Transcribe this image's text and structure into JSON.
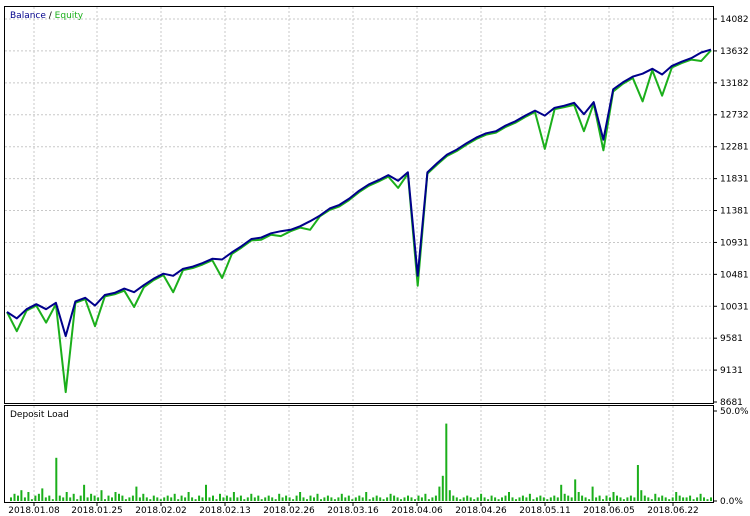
{
  "legend": {
    "balance_label": "Balance",
    "separator": " / ",
    "equity_label": "Equity"
  },
  "deposit_panel": {
    "title": "Deposit Load"
  },
  "colors": {
    "balance": "#00008B",
    "equity": "#1BAF1B",
    "deposit_bar": "#1BAF1B",
    "grid": "#C8C8C8",
    "frame": "#000000"
  },
  "chart_data": [
    {
      "type": "line",
      "title": "",
      "legend": [
        "Balance",
        "Equity"
      ],
      "legend_position": "top-left",
      "grid": true,
      "y_ticks": [
        "14082",
        "13632",
        "13182",
        "12732",
        "12281",
        "11831",
        "11381",
        "10931",
        "10481",
        "10031",
        "9581",
        "9131",
        "8681"
      ],
      "ylim": [
        8681,
        14082
      ],
      "x_ticks": [
        "2018.01.08",
        "2018.01.25",
        "2018.02.02",
        "2018.02.13",
        "2018.02.26",
        "2018.03.16",
        "2018.04.06",
        "2018.04.26",
        "2018.05.11",
        "2018.06.05",
        "2018.06.22"
      ],
      "series": [
        {
          "name": "Balance",
          "values": [
            9950,
            9860,
            9990,
            10060,
            9990,
            10080,
            9610,
            10100,
            10150,
            10040,
            10190,
            10220,
            10280,
            10230,
            10330,
            10420,
            10490,
            10460,
            10560,
            10590,
            10640,
            10700,
            10690,
            10790,
            10880,
            10980,
            11000,
            11060,
            11090,
            11110,
            11160,
            11230,
            11310,
            11410,
            11460,
            11550,
            11660,
            11750,
            11810,
            11880,
            11800,
            11920,
            10460,
            11920,
            12050,
            12170,
            12240,
            12330,
            12410,
            12470,
            12500,
            12580,
            12640,
            12720,
            12790,
            12720,
            12830,
            12860,
            12900,
            12740,
            12910,
            12380,
            13090,
            13190,
            13270,
            13310,
            13380,
            13300,
            13420,
            13480,
            13530,
            13610,
            13650
          ]
        },
        {
          "name": "Equity",
          "values": [
            9950,
            9680,
            9970,
            10040,
            9800,
            10060,
            8820,
            10080,
            10130,
            9750,
            10170,
            10200,
            10250,
            10020,
            10300,
            10400,
            10470,
            10230,
            10540,
            10570,
            10620,
            10680,
            10430,
            10770,
            10860,
            10960,
            10970,
            11040,
            11020,
            11090,
            11140,
            11110,
            11300,
            11390,
            11440,
            11530,
            11640,
            11730,
            11790,
            11860,
            11700,
            11900,
            10320,
            11900,
            12030,
            12150,
            12220,
            12310,
            12390,
            12450,
            12480,
            12560,
            12620,
            12700,
            12770,
            12250,
            12810,
            12840,
            12870,
            12500,
            12890,
            12230,
            13060,
            13170,
            13250,
            12920,
            13360,
            13000,
            13400,
            13460,
            13510,
            13490,
            13640
          ]
        }
      ]
    },
    {
      "type": "bar",
      "title": "Deposit Load",
      "y_ticks": [
        "50.0%",
        "0.0%"
      ],
      "ylim": [
        0,
        50
      ],
      "unit": "%",
      "values": [
        2,
        4,
        3,
        6,
        2,
        5,
        1,
        3,
        4,
        7,
        2,
        3,
        1,
        24,
        3,
        2,
        5,
        2,
        4,
        1,
        3,
        9,
        2,
        4,
        3,
        2,
        6,
        1,
        3,
        2,
        5,
        4,
        3,
        1,
        2,
        3,
        8,
        2,
        4,
        2,
        1,
        3,
        2,
        1,
        2,
        3,
        2,
        4,
        1,
        3,
        2,
        5,
        2,
        1,
        3,
        2,
        9,
        2,
        3,
        1,
        4,
        2,
        3,
        2,
        5,
        2,
        3,
        1,
        2,
        4,
        2,
        3,
        1,
        2,
        3,
        2,
        1,
        4,
        2,
        3,
        2,
        1,
        3,
        5,
        2,
        1,
        3,
        2,
        4,
        1,
        2,
        3,
        2,
        1,
        2,
        4,
        2,
        3,
        1,
        2,
        3,
        2,
        5,
        1,
        2,
        3,
        2,
        1,
        2,
        4,
        3,
        2,
        1,
        2,
        3,
        2,
        1,
        3,
        2,
        4,
        1,
        2,
        3,
        8,
        14,
        43,
        6,
        3,
        2,
        1,
        2,
        3,
        2,
        1,
        2,
        4,
        2,
        1,
        3,
        2,
        1,
        2,
        3,
        5,
        2,
        1,
        2,
        3,
        2,
        4,
        1,
        2,
        3,
        2,
        1,
        2,
        3,
        2,
        9,
        4,
        3,
        2,
        12,
        5,
        3,
        2,
        1,
        8,
        2,
        3,
        1,
        3,
        2,
        5,
        3,
        2,
        1,
        2,
        3,
        2,
        20,
        6,
        3,
        2,
        1,
        4,
        2,
        3,
        2,
        1,
        2,
        5,
        3,
        2,
        2,
        3,
        1,
        2,
        4,
        2,
        1,
        2
      ]
    }
  ]
}
